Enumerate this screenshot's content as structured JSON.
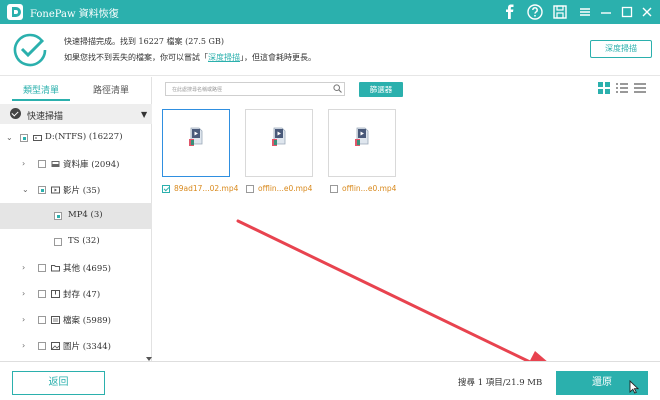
{
  "app": {
    "title": "FonePaw 資料恢復",
    "brand_color": "#2bb0ad",
    "titlebar_icons": [
      "facebook-icon",
      "help-icon",
      "save-icon",
      "menu-icon",
      "minimize-icon",
      "maximize-icon",
      "close-icon"
    ]
  },
  "status": {
    "line1": "快速掃描完成。找到 16227 檔案 (27.5 GB)",
    "line2_prefix": "如果您找不到丟失的檔案，你可以嘗試「",
    "line2_link": "深度掃描",
    "line2_suffix": "」，但這會耗時更長。",
    "deep_scan_button": "深度掃描"
  },
  "sidebar": {
    "tabs": [
      {
        "label": "類型清單",
        "active": true
      },
      {
        "label": "路徑清單",
        "active": false
      }
    ],
    "quick_scan_label": "快速掃描",
    "tree": [
      {
        "label": "D:(NTFS) (16227)",
        "icon": "drive-icon",
        "expanded": true,
        "check": "partial",
        "selected": false
      },
      {
        "label": "資料庫 (2094)",
        "icon": "database-icon",
        "expanded": false,
        "check": "none",
        "selected": false
      },
      {
        "label": "影片 (35)",
        "icon": "video-icon",
        "expanded": true,
        "check": "partial",
        "selected": false
      },
      {
        "label": "MP4 (3)",
        "icon": "",
        "expanded": false,
        "check": "partial",
        "selected": true
      },
      {
        "label": "TS (32)",
        "icon": "",
        "expanded": false,
        "check": "none",
        "selected": false
      },
      {
        "label": "其他 (4695)",
        "icon": "folder-icon",
        "expanded": false,
        "check": "none",
        "selected": false
      },
      {
        "label": "封存 (47)",
        "icon": "archive-icon",
        "expanded": false,
        "check": "none",
        "selected": false
      },
      {
        "label": "檔案 (5989)",
        "icon": "document-icon",
        "expanded": false,
        "check": "none",
        "selected": false
      },
      {
        "label": "圖片 (3344)",
        "icon": "image-icon",
        "expanded": false,
        "check": "none",
        "selected": false
      }
    ]
  },
  "main": {
    "search_placeholder": "在此處搜尋名稱或路徑",
    "filter_button": "篩選器",
    "view_modes": [
      "grid-view-icon",
      "list-view-icon",
      "detail-view-icon"
    ],
    "active_view": "grid-view-icon",
    "files": [
      {
        "name": "89ad17...02.mp4",
        "checked": true,
        "selected": true
      },
      {
        "name": "offlin...e0.mp4",
        "checked": false,
        "selected": false
      },
      {
        "name": "offlin...e0.mp4",
        "checked": false,
        "selected": false
      }
    ]
  },
  "footer": {
    "back_button": "返回",
    "selection_info": "搜尋 1 項目/21.9 MB",
    "restore_button": "還原"
  }
}
